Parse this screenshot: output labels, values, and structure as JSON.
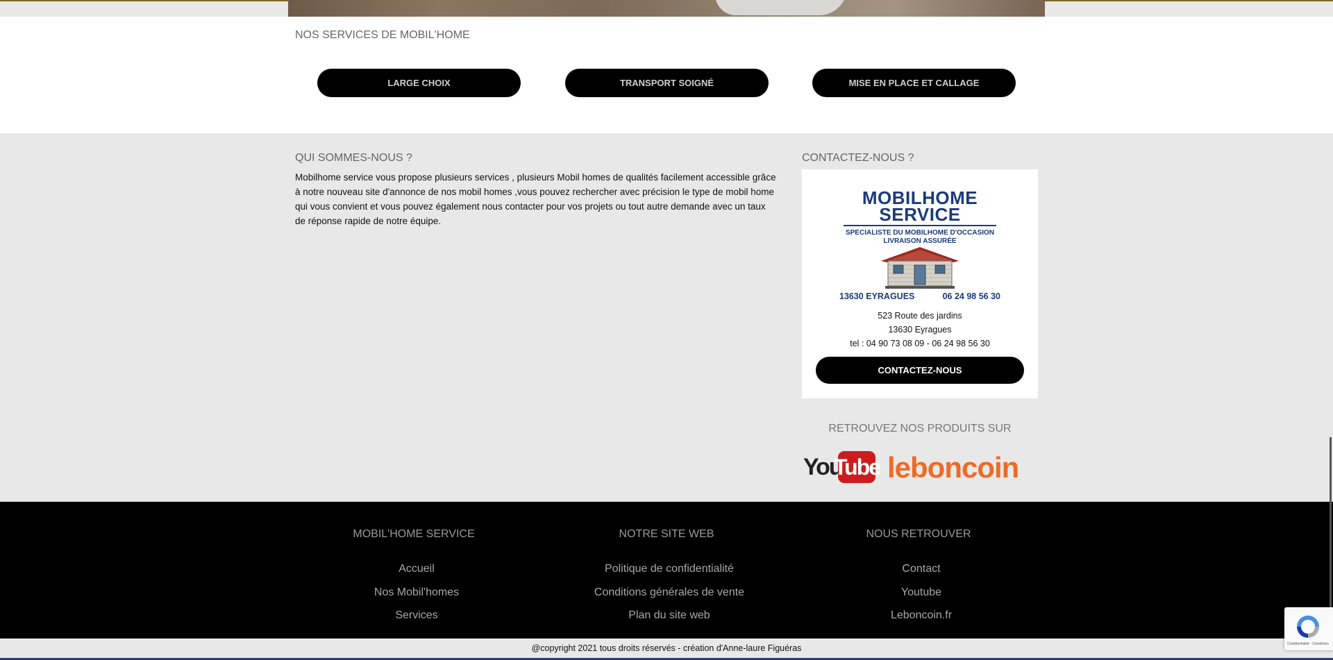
{
  "services": {
    "title": "NOS SERVICES DE MOBIL'HOME",
    "buttons": [
      "LARGE CHOIX",
      "TRANSPORT SOIGNÉ",
      "MISE EN PLACE ET CALLAGE"
    ]
  },
  "about": {
    "title": "QUI SOMMES-NOUS ?",
    "text": "Mobilhome service vous propose plusieurs services , plusieurs Mobil homes de qualités facilement accessible grâce à notre nouveau site d'annonce de nos mobil homes ,vous pouvez rechercher avec précision le type de mobil home qui vous convient et vous pouvez également nous contacter pour vos projets ou tout autre demande avec un taux de réponse rapide de notre équipe."
  },
  "contact": {
    "title": "CONTACTEZ-NOUS ?",
    "logo": {
      "line1": "MOBILHOME",
      "line2": "SERVICE",
      "sub1": "SPECIALISTE DU MOBILHOME D'OCCASION",
      "sub2": "LIVRAISON ASSURÉE",
      "city": "13630 EYRAGUES",
      "phone": "06 24 98 56 30"
    },
    "address1": "523 Route des jardins",
    "address2": "13630 Eyragues",
    "tel": "tel : 04 90 73 08 09 - 06 24 98 56 30",
    "button": "CONTACTEZ-NOUS"
  },
  "products": {
    "title": "RETROUVEZ NOS PRODUITS SUR",
    "youtube_you": "You",
    "youtube_tube": "Tube",
    "leboncoin": "leboncoin"
  },
  "footer": {
    "columns": [
      {
        "heading": "MOBIL'HOME SERVICE",
        "links": [
          "Accueil",
          "Nos Mobil'homes",
          "Services"
        ]
      },
      {
        "heading": "NOTRE SITE WEB",
        "links": [
          "Politique de confidentialité",
          "Conditions générales de vente",
          "Plan du site web"
        ]
      },
      {
        "heading": "NOUS RETROUVER",
        "links": [
          "Contact",
          "Youtube",
          "Leboncoin.fr"
        ]
      }
    ],
    "copyright": "@copyright 2021 tous droits réservés - création d'Anne-laure Figuéras"
  },
  "recaptcha": {
    "text": "Confidentialité - Conditions"
  },
  "colors": {
    "accent_black": "#000000",
    "youtube_red": "#cc1d1d",
    "leboncoin_orange": "#ee6b27",
    "logo_blue": "#1a3a7a"
  }
}
